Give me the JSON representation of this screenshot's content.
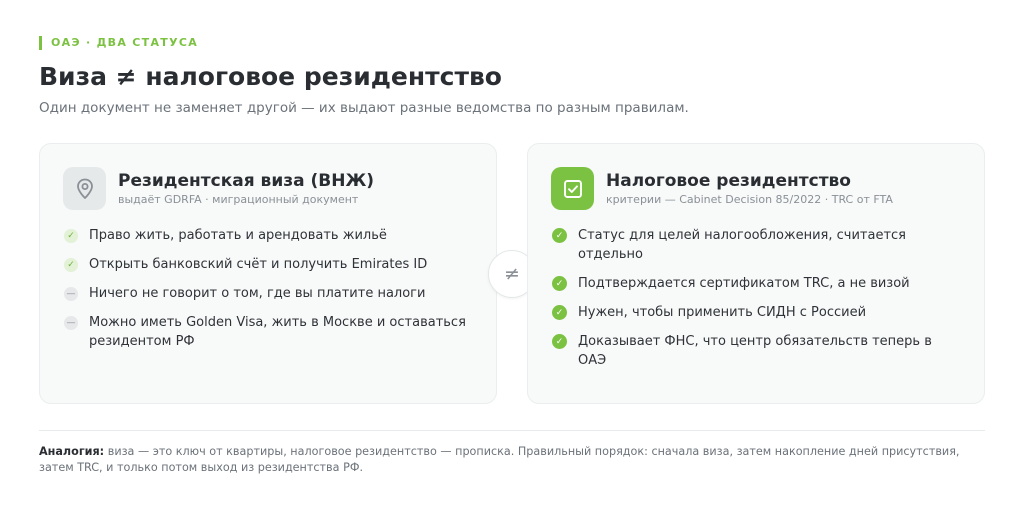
{
  "header": {
    "eyebrow": "ОАЭ · ДВА СТАТУСА",
    "title": "Виза ≠ налоговое резидентство",
    "subtitle": "Один документ не заменяет другой — их выдают разные ведомства по разным правилам."
  },
  "left_card": {
    "icon": "location-pin-icon",
    "title": "Резидентская виза (ВНЖ)",
    "subtitle": "выдаёт GDRFA · миграционный документ",
    "items": [
      {
        "text": "Право жить, работать и арендовать жильё",
        "marker": "check"
      },
      {
        "text": "Открыть банковский счёт и получить Emirates ID",
        "marker": "check"
      },
      {
        "text": "Ничего не говорит о том, где вы платите налоги",
        "marker": "dash"
      },
      {
        "text": "Можно иметь Golden Visa, жить в Москве и оставаться резидентом РФ",
        "marker": "dash"
      }
    ]
  },
  "separator": {
    "symbol": "≠"
  },
  "right_card": {
    "icon": "checkbox-icon",
    "title": "Налоговое резидентство",
    "subtitle": "критерии — Cabinet Decision 85/2022 · TRC от FTA",
    "items": [
      {
        "text": "Статус для целей налогообложения, считается отдельно",
        "marker": "check"
      },
      {
        "text": "Подтверждается сертификатом TRC, а не визой",
        "marker": "check"
      },
      {
        "text": "Нужен, чтобы применить СИДН с Россией",
        "marker": "check"
      },
      {
        "text": "Доказывает ФНС, что центр обязательств теперь в ОАЭ",
        "marker": "check"
      }
    ]
  },
  "footnote": {
    "label": "Аналогия:",
    "text": " виза — это ключ от квартиры, налоговое резидентство — прописка. Правильный порядок: сначала виза, затем накопление дней присутствия, затем TRC, и только потом выход из резидентства РФ."
  },
  "colors": {
    "accent": "#7cc242",
    "text": "#2a2e33",
    "muted": "#6b7279",
    "card_bg": "#f8f9f9"
  }
}
